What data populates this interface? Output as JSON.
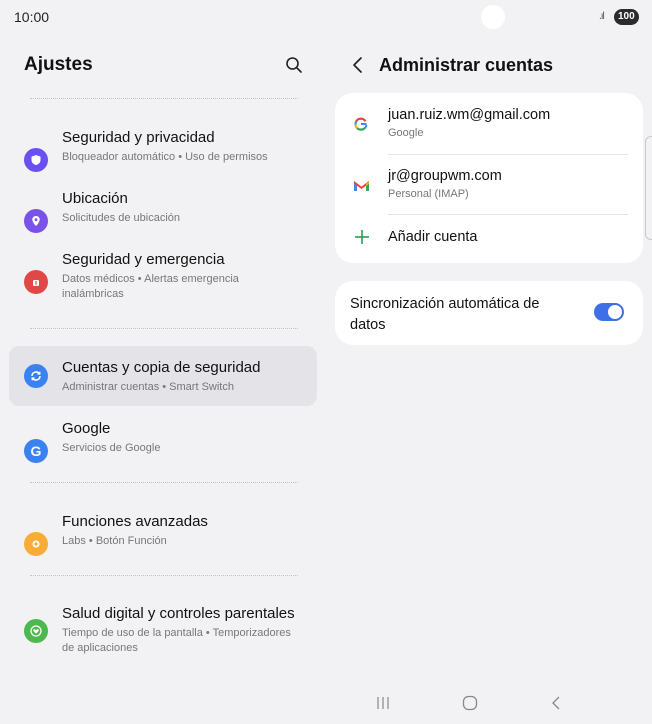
{
  "status_bar": {
    "time": "10:00",
    "signal": ".ıl",
    "battery": "100"
  },
  "left": {
    "title": "Ajustes",
    "items": [
      {
        "title": "Seguridad y privacidad",
        "subtitle": "Bloqueador automático  •  Uso de permisos",
        "icon": "shield-icon",
        "color": "#6b4ff0"
      },
      {
        "title": "Ubicación",
        "subtitle": "Solicitudes de ubicación",
        "icon": "location-pin-icon",
        "color": "#7b52e8"
      },
      {
        "title": "Seguridad y emergencia",
        "subtitle": "Datos médicos  •  Alertas emergencia inalámbricas",
        "icon": "emergency-icon",
        "color": "#e04848"
      },
      {
        "title": "Cuentas y copia de seguridad",
        "subtitle": "Administrar cuentas  •  Smart Switch",
        "icon": "sync-icon",
        "color": "#3a82f0"
      },
      {
        "title": "Google",
        "subtitle": "Servicios de Google",
        "icon": "google-icon",
        "color": "#3a82f0"
      },
      {
        "title": "Funciones avanzadas",
        "subtitle": "Labs  •  Botón Función",
        "icon": "gear-plus-icon",
        "color": "#f7ac38"
      },
      {
        "title": "Salud digital y controles parentales",
        "subtitle": "Tiempo de uso de la pantalla  •  Temporizadores de aplicaciones",
        "icon": "heart-circle-icon",
        "color": "#4cb84e"
      }
    ]
  },
  "right": {
    "title": "Administrar cuentas",
    "accounts": [
      {
        "email": "juan.ruiz.wm@gmail.com",
        "type": "Google",
        "icon": "google-g-icon"
      },
      {
        "email": "jr@groupwm.com",
        "type": "Personal (IMAP)",
        "icon": "gmail-icon"
      }
    ],
    "add_account": "Añadir cuenta",
    "sync": {
      "label": "Sincronización automática de datos",
      "enabled": true
    }
  },
  "colors": {
    "accent": "#3e6fe6",
    "add_green": "#1fa05a",
    "background": "#f2f2f4"
  }
}
